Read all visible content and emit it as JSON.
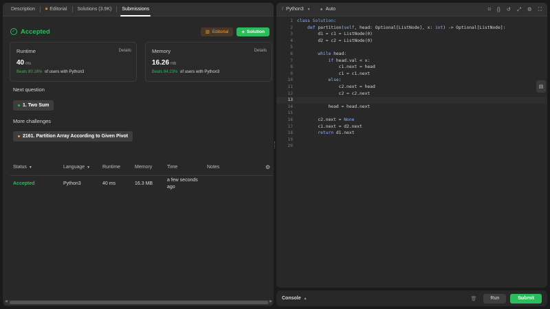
{
  "tabs": [
    {
      "label": "Description"
    },
    {
      "label": "Editorial"
    },
    {
      "label": "Solutions (3.9K)"
    },
    {
      "label": "Submissions"
    }
  ],
  "result": {
    "status": "Accepted",
    "editorial_label": "Editorial",
    "solution_label": "Solution"
  },
  "runtime": {
    "label": "Runtime",
    "details": "Details",
    "value": "40",
    "unit": "ms",
    "beats_pct": "Beats 80.16%",
    "beats_text": "of users with Python3"
  },
  "memory": {
    "label": "Memory",
    "details": "Details",
    "value": "16.26",
    "unit": "mb",
    "beats_pct": "Beats 84.23%",
    "beats_text": "of users with Python3"
  },
  "next_question": {
    "label": "Next question",
    "item": "1. Two Sum"
  },
  "more_challenges": {
    "label": "More challenges",
    "item": "2161. Partition Array According to Given Pivot"
  },
  "submissions_table": {
    "headers": [
      "Status",
      "Language",
      "Runtime",
      "Memory",
      "Time",
      "Notes"
    ],
    "rows": [
      {
        "status": "Accepted",
        "language": "Python3",
        "runtime": "40 ms",
        "memory": "16.3 MB",
        "time": "a few seconds ago",
        "notes": ""
      }
    ]
  },
  "editor": {
    "language": "Python3",
    "mode": "Auto",
    "current_line": 13,
    "lines": [
      "class Solution:",
      "    def partition(self, head: Optional[ListNode], x: int) -> Optional[ListNode]:",
      "        d1 = c1 = ListNode(0)",
      "        d2 = c2 = ListNode(0)",
      "",
      "        while head:",
      "            if head.val < x:",
      "                c1.next = head",
      "                c1 = c1.next",
      "            else:",
      "                c2.next = head",
      "                c2 = c2.next",
      "",
      "            head = head.next",
      "",
      "        c2.next = None",
      "        c1.next = d2.next",
      "        return d1.next",
      "",
      ""
    ]
  },
  "console": {
    "label": "Console",
    "run_label": "Run",
    "submit_label": "Submit"
  },
  "colors": {
    "accent_green": "#2cbb5d",
    "editorial_orange": "#f0a030",
    "panel_bg": "#282828",
    "page_bg": "#1a1a1a"
  }
}
